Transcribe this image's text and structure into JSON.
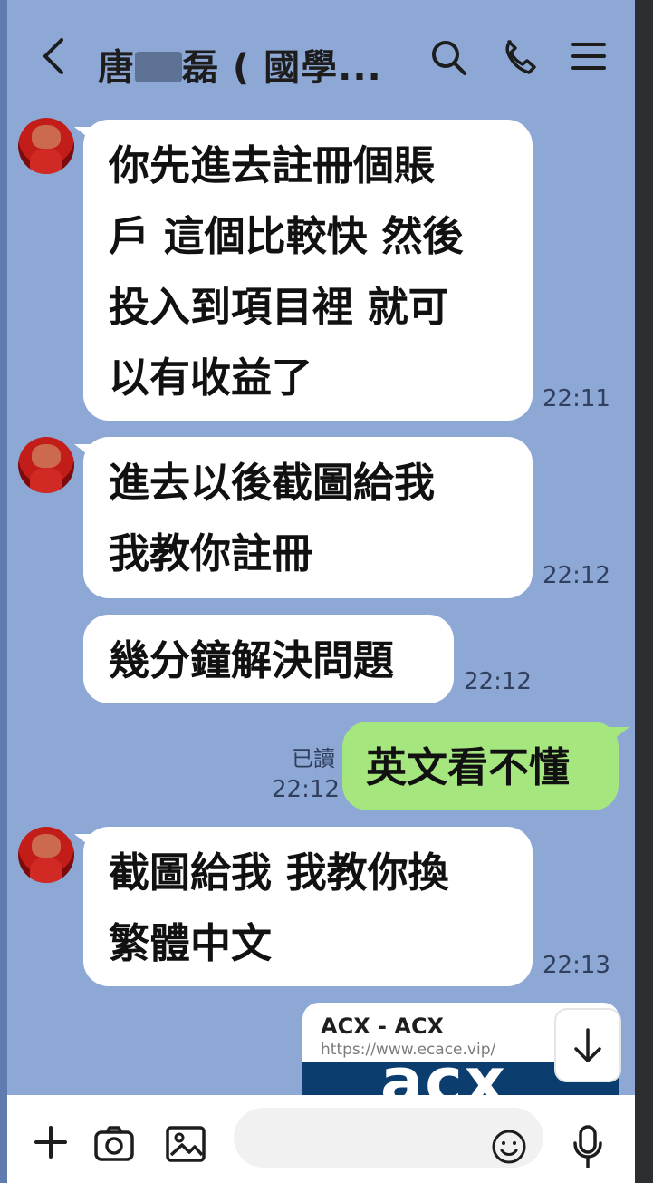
{
  "header": {
    "back_label": "<",
    "title_prefix": "唐",
    "title_suffix": "磊 ( 國學...",
    "icons": [
      "search-icon",
      "phone-icon",
      "menu-icon"
    ]
  },
  "messages": [
    {
      "lines": [
        "你先進去註冊個賬",
        "戶 這個比較快 然後",
        "投入到項目裡 就可",
        "以有收益了"
      ],
      "time": "22:11"
    },
    {
      "lines": [
        "進去以後截圖給我",
        "我教你註冊"
      ],
      "time": "22:12"
    },
    {
      "lines": [
        "幾分鐘解決問題"
      ],
      "time": "22:12"
    },
    {
      "lines": [
        "英文看不懂"
      ],
      "read": "已讀",
      "time": "22:12"
    },
    {
      "lines": [
        "截圖給我 我教你換",
        "繁體中文"
      ],
      "time": "22:13"
    }
  ],
  "link_preview": {
    "title": "ACX - ACX",
    "url": "https://www.ecace.vip/",
    "logo_text": "acx"
  },
  "bottom_bar": {
    "icons": [
      "plus-icon",
      "camera-icon",
      "image-icon",
      "emoji-icon",
      "microphone-icon"
    ]
  },
  "colors": {
    "background": "#8ea8d6",
    "incoming_bubble": "#ffffff",
    "outgoing_bubble": "#a5e67f",
    "text": "#111111"
  }
}
